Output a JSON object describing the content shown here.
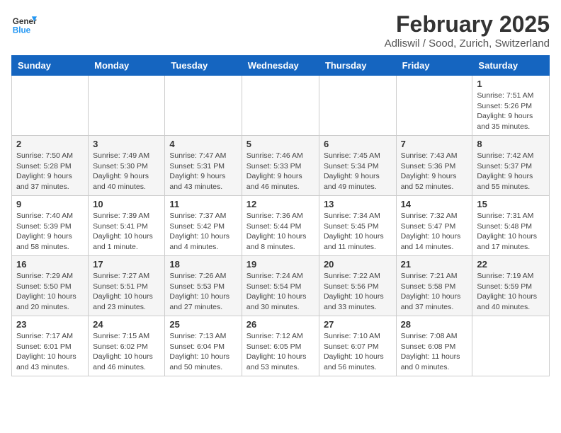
{
  "header": {
    "logo_general": "General",
    "logo_blue": "Blue",
    "month_year": "February 2025",
    "location": "Adliswil / Sood, Zurich, Switzerland"
  },
  "weekdays": [
    "Sunday",
    "Monday",
    "Tuesday",
    "Wednesday",
    "Thursday",
    "Friday",
    "Saturday"
  ],
  "weeks": [
    [
      {
        "day": "",
        "info": ""
      },
      {
        "day": "",
        "info": ""
      },
      {
        "day": "",
        "info": ""
      },
      {
        "day": "",
        "info": ""
      },
      {
        "day": "",
        "info": ""
      },
      {
        "day": "",
        "info": ""
      },
      {
        "day": "1",
        "info": "Sunrise: 7:51 AM\nSunset: 5:26 PM\nDaylight: 9 hours and 35 minutes."
      }
    ],
    [
      {
        "day": "2",
        "info": "Sunrise: 7:50 AM\nSunset: 5:28 PM\nDaylight: 9 hours and 37 minutes."
      },
      {
        "day": "3",
        "info": "Sunrise: 7:49 AM\nSunset: 5:30 PM\nDaylight: 9 hours and 40 minutes."
      },
      {
        "day": "4",
        "info": "Sunrise: 7:47 AM\nSunset: 5:31 PM\nDaylight: 9 hours and 43 minutes."
      },
      {
        "day": "5",
        "info": "Sunrise: 7:46 AM\nSunset: 5:33 PM\nDaylight: 9 hours and 46 minutes."
      },
      {
        "day": "6",
        "info": "Sunrise: 7:45 AM\nSunset: 5:34 PM\nDaylight: 9 hours and 49 minutes."
      },
      {
        "day": "7",
        "info": "Sunrise: 7:43 AM\nSunset: 5:36 PM\nDaylight: 9 hours and 52 minutes."
      },
      {
        "day": "8",
        "info": "Sunrise: 7:42 AM\nSunset: 5:37 PM\nDaylight: 9 hours and 55 minutes."
      }
    ],
    [
      {
        "day": "9",
        "info": "Sunrise: 7:40 AM\nSunset: 5:39 PM\nDaylight: 9 hours and 58 minutes."
      },
      {
        "day": "10",
        "info": "Sunrise: 7:39 AM\nSunset: 5:41 PM\nDaylight: 10 hours and 1 minute."
      },
      {
        "day": "11",
        "info": "Sunrise: 7:37 AM\nSunset: 5:42 PM\nDaylight: 10 hours and 4 minutes."
      },
      {
        "day": "12",
        "info": "Sunrise: 7:36 AM\nSunset: 5:44 PM\nDaylight: 10 hours and 8 minutes."
      },
      {
        "day": "13",
        "info": "Sunrise: 7:34 AM\nSunset: 5:45 PM\nDaylight: 10 hours and 11 minutes."
      },
      {
        "day": "14",
        "info": "Sunrise: 7:32 AM\nSunset: 5:47 PM\nDaylight: 10 hours and 14 minutes."
      },
      {
        "day": "15",
        "info": "Sunrise: 7:31 AM\nSunset: 5:48 PM\nDaylight: 10 hours and 17 minutes."
      }
    ],
    [
      {
        "day": "16",
        "info": "Sunrise: 7:29 AM\nSunset: 5:50 PM\nDaylight: 10 hours and 20 minutes."
      },
      {
        "day": "17",
        "info": "Sunrise: 7:27 AM\nSunset: 5:51 PM\nDaylight: 10 hours and 23 minutes."
      },
      {
        "day": "18",
        "info": "Sunrise: 7:26 AM\nSunset: 5:53 PM\nDaylight: 10 hours and 27 minutes."
      },
      {
        "day": "19",
        "info": "Sunrise: 7:24 AM\nSunset: 5:54 PM\nDaylight: 10 hours and 30 minutes."
      },
      {
        "day": "20",
        "info": "Sunrise: 7:22 AM\nSunset: 5:56 PM\nDaylight: 10 hours and 33 minutes."
      },
      {
        "day": "21",
        "info": "Sunrise: 7:21 AM\nSunset: 5:58 PM\nDaylight: 10 hours and 37 minutes."
      },
      {
        "day": "22",
        "info": "Sunrise: 7:19 AM\nSunset: 5:59 PM\nDaylight: 10 hours and 40 minutes."
      }
    ],
    [
      {
        "day": "23",
        "info": "Sunrise: 7:17 AM\nSunset: 6:01 PM\nDaylight: 10 hours and 43 minutes."
      },
      {
        "day": "24",
        "info": "Sunrise: 7:15 AM\nSunset: 6:02 PM\nDaylight: 10 hours and 46 minutes."
      },
      {
        "day": "25",
        "info": "Sunrise: 7:13 AM\nSunset: 6:04 PM\nDaylight: 10 hours and 50 minutes."
      },
      {
        "day": "26",
        "info": "Sunrise: 7:12 AM\nSunset: 6:05 PM\nDaylight: 10 hours and 53 minutes."
      },
      {
        "day": "27",
        "info": "Sunrise: 7:10 AM\nSunset: 6:07 PM\nDaylight: 10 hours and 56 minutes."
      },
      {
        "day": "28",
        "info": "Sunrise: 7:08 AM\nSunset: 6:08 PM\nDaylight: 11 hours and 0 minutes."
      },
      {
        "day": "",
        "info": ""
      }
    ]
  ]
}
